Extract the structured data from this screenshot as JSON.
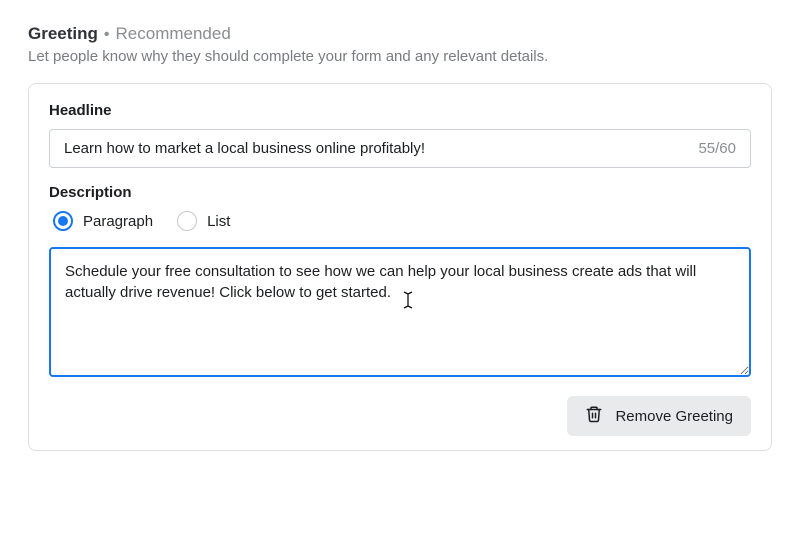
{
  "header": {
    "title": "Greeting",
    "dot": "•",
    "recommended": "Recommended",
    "subtext": "Let people know why they should complete your form and any relevant details."
  },
  "headline": {
    "label": "Headline",
    "value": "Learn how to market a local business online profitably!",
    "char_count": "55/60"
  },
  "description": {
    "label": "Description",
    "options": {
      "paragraph": "Paragraph",
      "list": "List"
    },
    "selected": "paragraph",
    "value": "Schedule your free consultation to see how we can help your local business create ads that will actually drive revenue! Click below to get started."
  },
  "actions": {
    "remove": "Remove Greeting"
  }
}
